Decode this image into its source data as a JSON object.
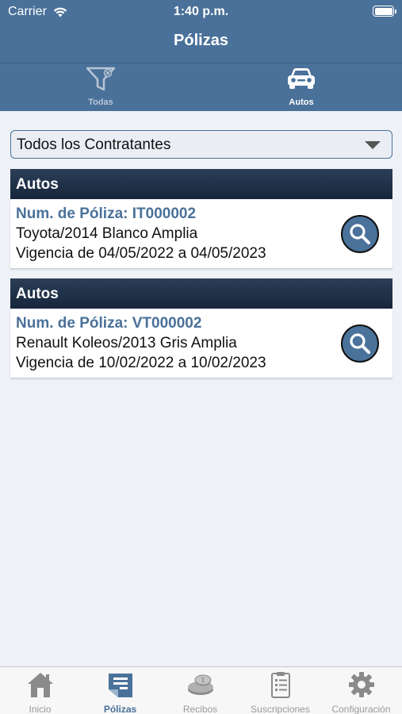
{
  "status_bar": {
    "carrier": "Carrier",
    "time": "1:40 p.m."
  },
  "nav": {
    "title": "Pólizas"
  },
  "filter_tabs": [
    {
      "label": "Todas",
      "icon": "filter-icon",
      "active": false
    },
    {
      "label": "Autos",
      "icon": "car-icon",
      "active": true
    }
  ],
  "contractor_select": {
    "value": "Todos los Contratantes"
  },
  "policies": [
    {
      "category": "Autos",
      "number": "Num. de Póliza: IT000002",
      "vehicle": "Toyota/2014 Blanco Amplia",
      "validity": "Vigencia de 04/05/2022 a 04/05/2023"
    },
    {
      "category": "Autos",
      "number": "Num. de Póliza: VT000002",
      "vehicle": "Renault Koleos/2013 Gris Amplia",
      "validity": "Vigencia de 10/02/2022 a 10/02/2023"
    }
  ],
  "tabbar": {
    "items": [
      {
        "label": "Inicio",
        "icon": "home-icon"
      },
      {
        "label": "Pólizas",
        "icon": "policies-icon",
        "active": true
      },
      {
        "label": "Recibos",
        "icon": "receipts-icon"
      },
      {
        "label": "Suscripciones",
        "icon": "subscriptions-icon"
      },
      {
        "label": "Configuración",
        "icon": "settings-icon"
      }
    ]
  },
  "colors": {
    "primary": "#4a7199",
    "section_header": "#1e2f45",
    "background": "#eef1f6"
  }
}
